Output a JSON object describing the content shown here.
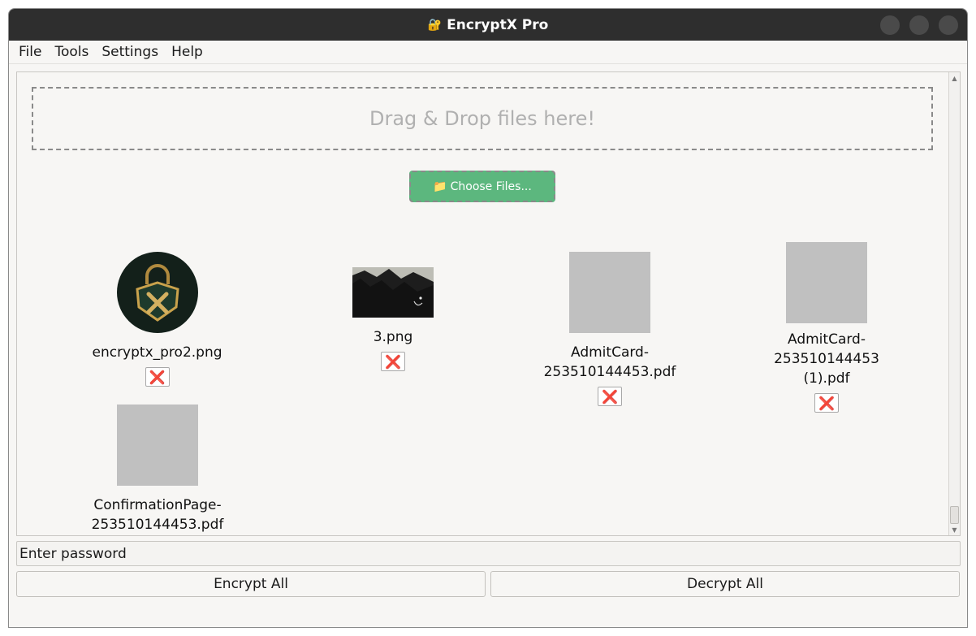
{
  "window": {
    "title": "EncryptX Pro",
    "title_icon": "lock-key-icon"
  },
  "menu": [
    "File",
    "Tools",
    "Settings",
    "Help"
  ],
  "dropzone": {
    "text": "Drag & Drop files here!"
  },
  "choose_button": {
    "label": "Choose Files...",
    "icon": "folder-icon"
  },
  "files": [
    {
      "name": "encryptx_pro2.png",
      "thumb": "logo",
      "remove": "❌"
    },
    {
      "name": "3.png",
      "thumb": "photo",
      "remove": "❌"
    },
    {
      "name": "AdmitCard-253510144453.pdf",
      "thumb": "placeholder",
      "remove": "❌"
    },
    {
      "name_line1": "AdmitCard-253510144453",
      "name_line2": "(1).pdf",
      "thumb": "placeholder",
      "remove": "❌"
    },
    {
      "name": "ConfirmationPage-253510144453.pdf",
      "thumb": "placeholder",
      "remove": "❌"
    }
  ],
  "password": {
    "placeholder": "Enter password"
  },
  "actions": {
    "encrypt": "Encrypt All",
    "decrypt": "Decrypt All"
  },
  "colors": {
    "titlebar": "#2e2e2e",
    "choose_button": "#5cb77e",
    "remove_icon": "#d32020",
    "placeholder_thumb": "#c0c0c0"
  }
}
